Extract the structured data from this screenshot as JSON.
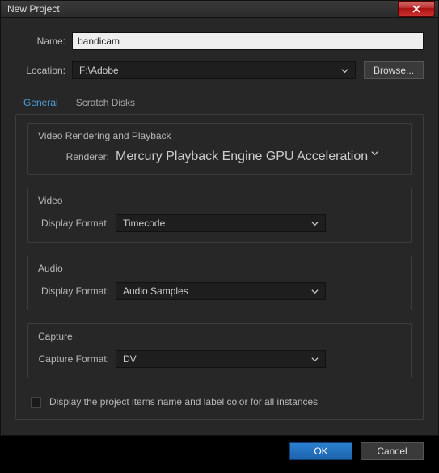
{
  "window": {
    "title": "New Project"
  },
  "fields": {
    "name_label": "Name:",
    "name_value": "bandicam",
    "location_label": "Location:",
    "location_value": "F:\\Adobe",
    "browse_label": "Browse..."
  },
  "tabs": {
    "general": "General",
    "scratch": "Scratch Disks"
  },
  "groups": {
    "render": {
      "title": "Video Rendering and Playback",
      "renderer_label": "Renderer:",
      "renderer_value": "Mercury Playback Engine GPU Acceleration"
    },
    "video": {
      "title": "Video",
      "format_label": "Display Format:",
      "format_value": "Timecode"
    },
    "audio": {
      "title": "Audio",
      "format_label": "Display Format:",
      "format_value": "Audio Samples"
    },
    "capture": {
      "title": "Capture",
      "format_label": "Capture Format:",
      "format_value": "DV"
    }
  },
  "checkbox": {
    "label": "Display the project items name and label color for all instances"
  },
  "buttons": {
    "ok": "OK",
    "cancel": "Cancel"
  }
}
